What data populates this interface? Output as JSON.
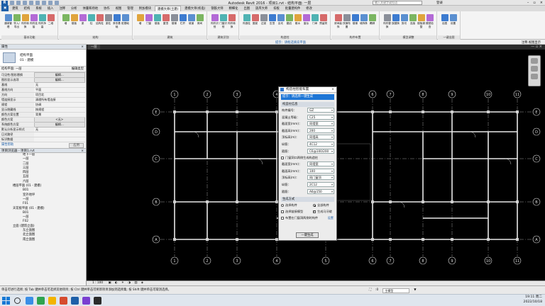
{
  "titlebar": {
    "title": "Autodesk Revit 2016 -  项目1.rvt - 结构平面: 一层",
    "search_placeholder": "输入关键字或短语",
    "user": "登录",
    "app_letter": "R"
  },
  "menu_tabs": [
    "",
    "建筑",
    "结构",
    "系统",
    "插入",
    "注释",
    "分析",
    "体量和场地",
    "协作",
    "视图",
    "管理",
    "附加模块",
    "建模大师(土建)",
    "建模大师(机电)",
    "钢筋大师",
    "精细化",
    "出图",
    "族库大师",
    "扣板",
    "批量建构件",
    "修改"
  ],
  "active_tab_index": 12,
  "ribbon_groups": [
    {
      "title": "基本功能",
      "buttons": [
        "通用管理",
        "导入/导出",
        "构件转换",
        "构件连接",
        "构件净高",
        "二维"
      ]
    },
    {
      "title": "结构",
      "buttons": [
        "墙",
        "楼板",
        "梁",
        "柱",
        "结构柱",
        "梁柱",
        "条形基础",
        "桩基础"
      ]
    },
    {
      "title": "建筑",
      "buttons": [
        "墙",
        "门窗",
        "楼板",
        "屋顶",
        "楼梯",
        "栏杆",
        "坡道",
        "房间"
      ]
    },
    {
      "title": "建筑识别",
      "buttons": [
        "构件识别",
        "门窗识别",
        "构件转换"
      ]
    },
    {
      "title": "构造柱",
      "buttons": [
        "构造柱",
        "圈梁",
        "过梁",
        "压顶",
        "反坎",
        "翻边",
        "散水",
        "窗台",
        "门垛",
        "预留洞"
      ]
    },
    {
      "title": "构件布置",
      "buttons": [
        "房间装饰",
        "快速布置",
        "楼梯",
        "墙饰条",
        "踢脚"
      ]
    },
    {
      "title": "模型调整",
      "buttons": [
        "构件替换",
        "族替换",
        "剪切",
        "连接",
        "楼板调整",
        "模型检查"
      ]
    },
    {
      "title": "一键出图",
      "buttons": [
        "出图",
        "设置"
      ]
    }
  ],
  "hint": {
    "text": "提示：请框选填充平面",
    "right": "注释  视图显示"
  },
  "properties": {
    "header": "属性",
    "type_line1": "结构平面",
    "type_line2": "01 - 建模",
    "selector": "结构平面: 一层",
    "edit_type": "编辑类型",
    "rows": [
      {
        "k": "可见性/图形替换",
        "v": "编辑...",
        "btn": true
      },
      {
        "k": "图形显示选项",
        "v": "编辑...",
        "btn": true
      },
      {
        "k": "基线",
        "v": "无",
        "btn": false
      },
      {
        "k": "基线方向",
        "v": "平面",
        "btn": false
      },
      {
        "k": "方向",
        "v": "项目北",
        "btn": false
      },
      {
        "k": "墙连接显示",
        "v": "清理所有墙连接",
        "btn": false
      },
      {
        "k": "规程",
        "v": "协调",
        "btn": false
      },
      {
        "k": "显示隐藏线",
        "v": "按规程",
        "btn": false
      },
      {
        "k": "颜色方案位置",
        "v": "背景",
        "btn": false
      },
      {
        "k": "颜色方案",
        "v": "<无>",
        "btn": true
      },
      {
        "k": "系统颜色方案",
        "v": "编辑...",
        "btn": true
      },
      {
        "k": "默认分析显示样式",
        "v": "无",
        "btn": false
      },
      {
        "k": "日光路径",
        "v": "",
        "btn": false
      },
      {
        "k": "标识数据",
        "v": "",
        "btn": false
      }
    ],
    "help": "属性帮助",
    "apply": "应用"
  },
  "browser": {
    "header": "项目浏览器 - 项目1.rvt",
    "items": [
      "地下一层",
      "一层",
      "二层",
      "三层",
      "四层",
      "五层",
      "六层",
      "楼层平面 (01 - 建模)",
      "B01",
      "室外地坪",
      "一层",
      "F01",
      "天花板平面 (01 - 建模)",
      "B01",
      "一层",
      "F02",
      "立面 (建筑立面)",
      "东立面图",
      "北立面图",
      "南立面图"
    ],
    "indents": [
      2,
      2,
      2,
      2,
      2,
      2,
      2,
      1,
      2,
      2,
      2,
      2,
      1,
      2,
      2,
      2,
      1,
      2,
      2,
      2
    ]
  },
  "view": {
    "tab": "一层",
    "controls": "— ▫ ×",
    "scale": "1 : 100",
    "grid_top": [
      "1",
      "2",
      "3",
      "4",
      "5",
      "6",
      "7",
      "8",
      "9",
      "10",
      "11"
    ],
    "grid_left": [
      "A",
      "B",
      "C",
      "D",
      "E"
    ]
  },
  "dialog": {
    "title": "构造柱智能布置",
    "hint": "提示：请选择一键生成",
    "section1": "构造柱信息",
    "fields1": [
      {
        "label": "构件编号：",
        "value": "GZ"
      },
      {
        "label": "混凝土等级：",
        "value": "C25"
      },
      {
        "label": "截面宽(mm)：",
        "value": "同墙宽"
      },
      {
        "label": "截面高(mm)：",
        "value": "200"
      },
      {
        "label": "顶标高(m)：",
        "value": "同墙高"
      },
      {
        "label": "纵筋：",
        "value": "4C12"
      },
      {
        "label": "箍筋：",
        "value": "C6@100/200"
      }
    ],
    "chk_door": "门窗洞口两侧生成构造柱",
    "fields2": [
      {
        "label": "截面宽(mm)：",
        "value": "同墙宽"
      },
      {
        "label": "截面高(mm)：",
        "value": "100"
      },
      {
        "label": "顶标高(m)：",
        "value": "同门窗顶"
      },
      {
        "label": "纵筋：",
        "value": "2C12"
      },
      {
        "label": "箍筋：",
        "value": "A6@150"
      }
    ],
    "section2": "生成方式",
    "radio1": "选择构件",
    "radio2": "全部构件",
    "chk1": "选择链接模型",
    "chk2": "生成马牙槎",
    "chk3": "布置在门窗洞两侧时构件",
    "setting": "设置",
    "generate": "一键生成"
  },
  "status": {
    "text": "单击可进行选择; 按 Tab 键并单击可选择其他项目; 按 Ctrl 键并单击可将新项目添加到选择集; 按 Shift 键并单击可取消选择。",
    "model": ":0",
    "main_model": "主模型"
  },
  "taskbar": {
    "time": "19:11 周二",
    "date": "2022/10/18",
    "app_colors": [
      "#3a8ee6",
      "#2ea44f",
      "#f3b400",
      "#d64b2e",
      "#1e5fa8",
      "#7a3fd1",
      "#2b2b2b"
    ]
  }
}
